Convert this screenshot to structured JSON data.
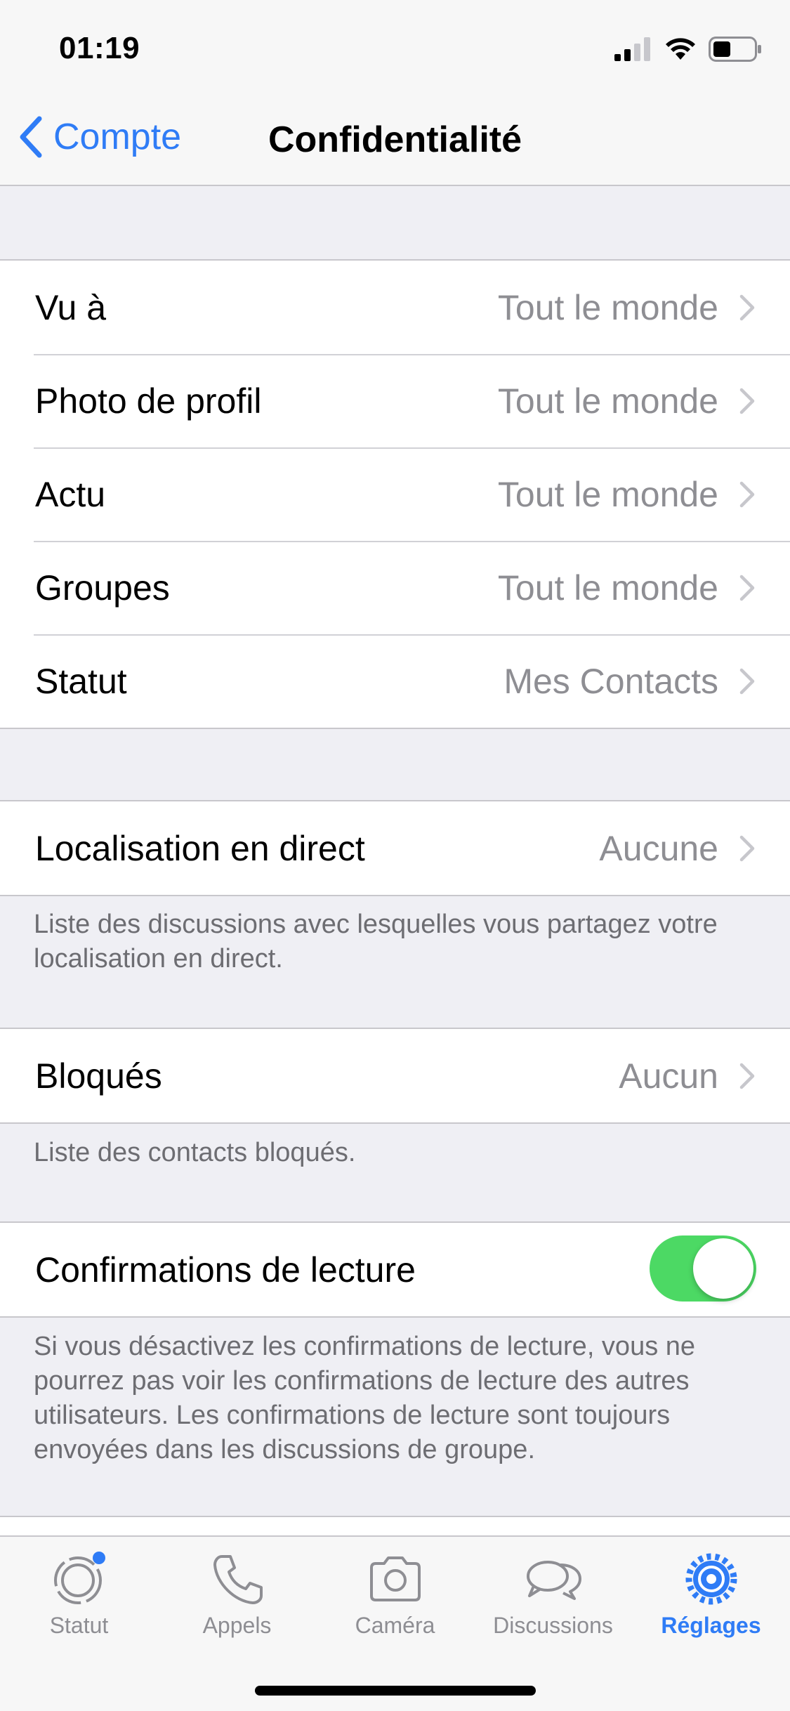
{
  "status_bar": {
    "time": "01:19"
  },
  "nav": {
    "back_label": "Compte",
    "title": "Confidentialité"
  },
  "privacy_rows": [
    {
      "label": "Vu à",
      "value": "Tout le monde"
    },
    {
      "label": "Photo de profil",
      "value": "Tout le monde"
    },
    {
      "label": "Actu",
      "value": "Tout le monde"
    },
    {
      "label": "Groupes",
      "value": "Tout le monde"
    },
    {
      "label": "Statut",
      "value": "Mes Contacts"
    }
  ],
  "live_location": {
    "label": "Localisation en direct",
    "value": "Aucune",
    "footnote": "Liste des discussions avec lesquelles vous partagez votre localisation en direct."
  },
  "blocked": {
    "label": "Bloqués",
    "value": "Aucun",
    "footnote": "Liste des contacts bloqués."
  },
  "read_receipts": {
    "label": "Confirmations de lecture",
    "enabled": true,
    "footnote": "Si vous désactivez les confirmations de lecture, vous ne pourrez pas voir les confirmations de lecture des autres utilisateurs. Les confirmations de lecture sont toujours envoyées dans les discussions de groupe."
  },
  "tab_bar": {
    "tabs": [
      {
        "label": "Statut",
        "icon": "status-icon"
      },
      {
        "label": "Appels",
        "icon": "phone-icon"
      },
      {
        "label": "Caméra",
        "icon": "camera-icon"
      },
      {
        "label": "Discussions",
        "icon": "chat-bubbles-icon"
      },
      {
        "label": "Réglages",
        "icon": "gear-icon",
        "active": true
      }
    ]
  },
  "colors": {
    "accent": "#2f7cf6",
    "toggle_on": "#4cd964",
    "secondary_text": "#8e8e93"
  }
}
